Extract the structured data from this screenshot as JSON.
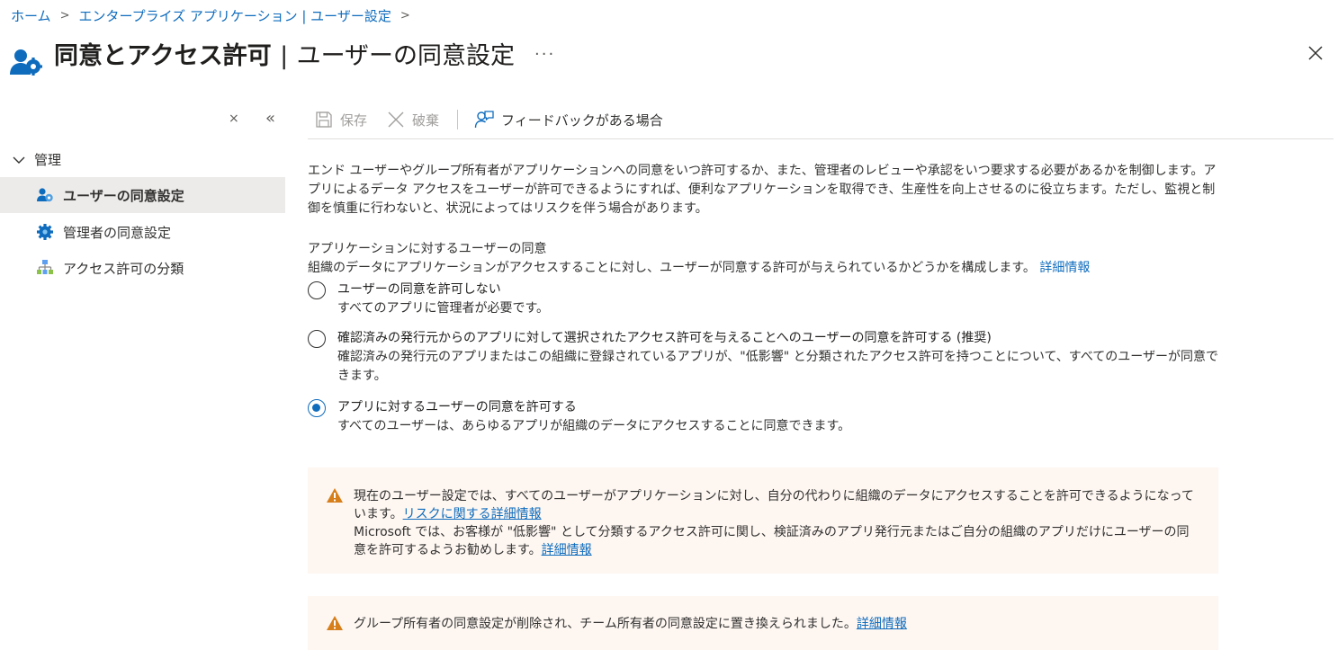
{
  "breadcrumb": {
    "items": [
      "ホーム",
      "エンタープライズ アプリケーション | ユーザー設定"
    ]
  },
  "header": {
    "title": "同意とアクセス許可",
    "separator": "|",
    "subtitle": "ユーザーの同意設定",
    "more": "···"
  },
  "sidebar": {
    "close_glyph": "×",
    "collapse_glyph": "«",
    "group_label": "管理",
    "items": [
      {
        "label": "ユーザーの同意設定",
        "icon": "user-consent-icon",
        "active": true
      },
      {
        "label": "管理者の同意設定",
        "icon": "gear-icon",
        "active": false
      },
      {
        "label": "アクセス許可の分類",
        "icon": "hierarchy-icon",
        "active": false
      }
    ]
  },
  "toolbar": {
    "save_label": "保存",
    "discard_label": "破棄",
    "feedback_label": "フィードバックがある場合"
  },
  "main": {
    "description": "エンド ユーザーやグループ所有者がアプリケーションへの同意をいつ許可するか、また、管理者のレビューや承認をいつ要求する必要があるかを制御します。アプリによるデータ アクセスをユーザーが許可できるようにすれば、便利なアプリケーションを取得でき、生産性を向上させるのに役立ちます。ただし、監視と制御を慎重に行わないと、状況によってはリスクを伴う場合があります。",
    "section_title": "アプリケーションに対するユーザーの同意",
    "section_desc": "組織のデータにアプリケーションがアクセスすることに対し、ユーザーが同意する許可が与えられているかどうかを構成します。",
    "section_link": "詳細情報",
    "options": [
      {
        "label": "ユーザーの同意を許可しない",
        "sub": "すべてのアプリに管理者が必要です。",
        "checked": false
      },
      {
        "label": "確認済みの発行元からのアプリに対して選択されたアクセス許可を与えることへのユーザーの同意を許可する (推奨)",
        "sub": "確認済みの発行元のアプリまたはこの組織に登録されているアプリが、\"低影響\" と分類されたアクセス許可を持つことについて、すべてのユーザーが同意できます。",
        "checked": false
      },
      {
        "label": "アプリに対するユーザーの同意を許可する",
        "sub": "すべてのユーザーは、あらゆるアプリが組織のデータにアクセスすることに同意できます。",
        "checked": true
      }
    ],
    "warning1": {
      "text1": "現在のユーザー設定では、すべてのユーザーがアプリケーションに対し、自分の代わりに組織のデータにアクセスすることを許可できるようになっています。",
      "link1": "リスクに関する詳細情報",
      "text2": "Microsoft では、お客様が \"低影響\" として分類するアクセス許可に関し、検証済みのアプリ発行元またはご自分の組織のアプリだけにユーザーの同意を許可するようお勧めします。",
      "link2": "詳細情報"
    },
    "warning2": {
      "text": "グループ所有者の同意設定が削除され、チーム所有者の同意設定に置き換えられました。",
      "link": "詳細情報"
    }
  },
  "colors": {
    "accent": "#0f6cbd",
    "warning": "#d67f1b",
    "warning_bg": "#fdf6f1",
    "active_nav": "#edebe9"
  }
}
